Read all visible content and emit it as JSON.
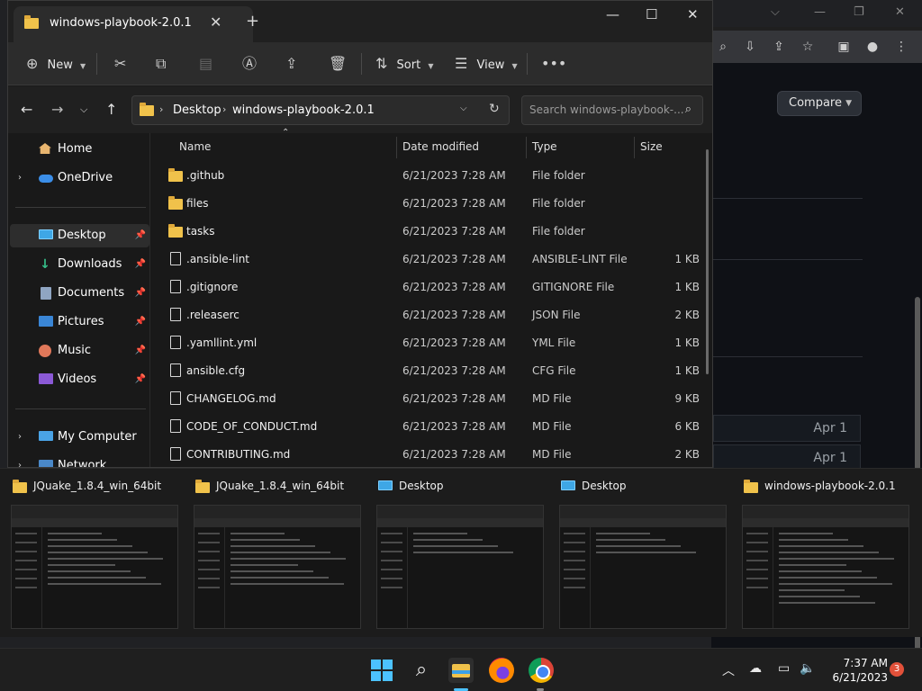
{
  "explorer": {
    "tab_title": "windows-playbook-2.0.1",
    "toolbar": {
      "new_label": "New",
      "sort_label": "Sort",
      "view_label": "View"
    },
    "breadcrumb": [
      "Desktop",
      "windows-playbook-2.0.1"
    ],
    "search_placeholder": "Search windows-playbook-...",
    "nav": {
      "home": "Home",
      "onedrive": "OneDrive",
      "desktop": "Desktop",
      "downloads": "Downloads",
      "documents": "Documents",
      "pictures": "Pictures",
      "music": "Music",
      "videos": "Videos",
      "my_computer": "My Computer",
      "network": "Network"
    },
    "columns": {
      "name": "Name",
      "date": "Date modified",
      "type": "Type",
      "size": "Size"
    },
    "files": [
      {
        "name": ".github",
        "date": "6/21/2023 7:28 AM",
        "type": "File folder",
        "size": "",
        "kind": "folder"
      },
      {
        "name": "files",
        "date": "6/21/2023 7:28 AM",
        "type": "File folder",
        "size": "",
        "kind": "folder"
      },
      {
        "name": "tasks",
        "date": "6/21/2023 7:28 AM",
        "type": "File folder",
        "size": "",
        "kind": "folder"
      },
      {
        "name": ".ansible-lint",
        "date": "6/21/2023 7:28 AM",
        "type": "ANSIBLE-LINT File",
        "size": "1 KB",
        "kind": "doc"
      },
      {
        "name": ".gitignore",
        "date": "6/21/2023 7:28 AM",
        "type": "GITIGNORE File",
        "size": "1 KB",
        "kind": "doc"
      },
      {
        "name": ".releaserc",
        "date": "6/21/2023 7:28 AM",
        "type": "JSON File",
        "size": "2 KB",
        "kind": "doc"
      },
      {
        "name": ".yamllint.yml",
        "date": "6/21/2023 7:28 AM",
        "type": "YML File",
        "size": "1 KB",
        "kind": "doc"
      },
      {
        "name": "ansible.cfg",
        "date": "6/21/2023 7:28 AM",
        "type": "CFG File",
        "size": "1 KB",
        "kind": "doc"
      },
      {
        "name": "CHANGELOG.md",
        "date": "6/21/2023 7:28 AM",
        "type": "MD File",
        "size": "9 KB",
        "kind": "doc"
      },
      {
        "name": "CODE_OF_CONDUCT.md",
        "date": "6/21/2023 7:28 AM",
        "type": "MD File",
        "size": "6 KB",
        "kind": "doc"
      },
      {
        "name": "CONTRIBUTING.md",
        "date": "6/21/2023 7:28 AM",
        "type": "MD File",
        "size": "2 KB",
        "kind": "doc"
      }
    ]
  },
  "browser": {
    "compare_label": "Compare",
    "rows": [
      "Apr 1",
      "Apr 1"
    ]
  },
  "alt_tab": [
    {
      "title": "JQuake_1.8.4_win_64bit",
      "icon": "zip-folder-icon"
    },
    {
      "title": "JQuake_1.8.4_win_64bit",
      "icon": "folder-icon"
    },
    {
      "title": "Desktop",
      "icon": "desktop-icon"
    },
    {
      "title": "Desktop",
      "icon": "desktop-icon"
    },
    {
      "title": "windows-playbook-2.0.1",
      "icon": "folder-icon"
    }
  ],
  "taskbar": {
    "time": "7:37 AM",
    "date": "6/21/2023",
    "notification_count": "3"
  },
  "colors": {
    "accent": "#4cc2ff",
    "folder": "#f0c24b",
    "badge": "#e2513a"
  }
}
